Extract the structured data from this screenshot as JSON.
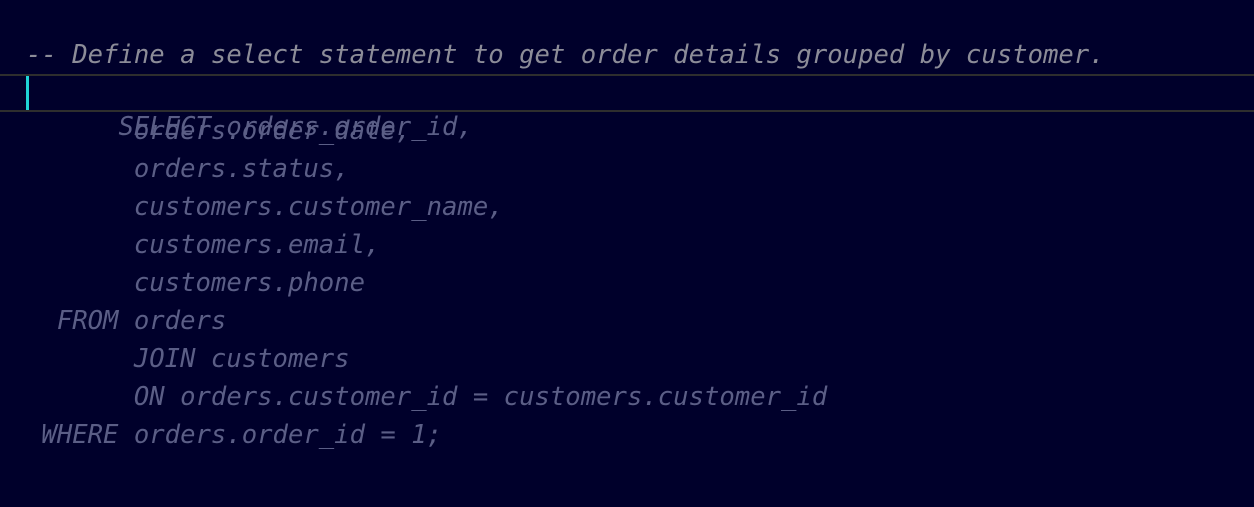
{
  "editor": {
    "lines": [
      "-- Define a select statement to get order details grouped by customer.",
      "SELECT orders.order_id,",
      "       orders.order_date,",
      "       orders.status,",
      "       customers.customer_name,",
      "       customers.email,",
      "       customers.phone",
      "  FROM orders",
      "       JOIN customers",
      "       ON orders.customer_id = customers.customer_id",
      " WHERE orders.order_id = 1;"
    ],
    "colors": {
      "background": "#00002b",
      "comment": "#8c8c98",
      "code": "#5b5e86",
      "cursor": "#1fd3d6",
      "current_line_border": "#2e2e2e"
    }
  }
}
